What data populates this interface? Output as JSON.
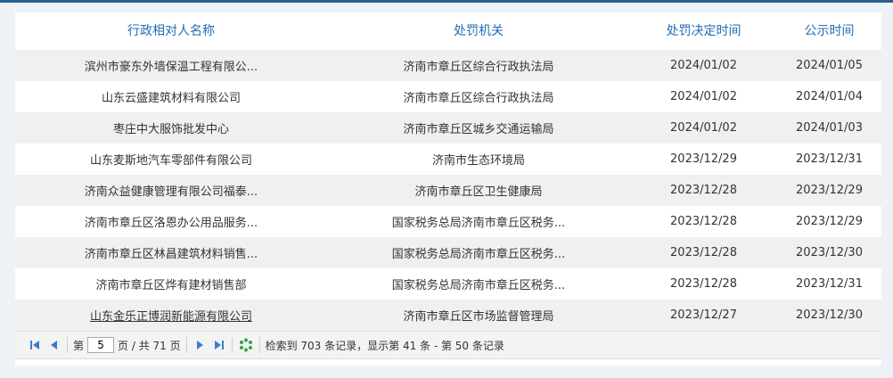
{
  "table": {
    "headers": [
      "行政相对人名称",
      "处罚机关",
      "处罚决定时间",
      "公示时间"
    ],
    "rows": [
      [
        "滨州市豪东外墙保温工程有限公...",
        "济南市章丘区综合行政执法局",
        "2024/01/02",
        "2024/01/05"
      ],
      [
        "山东云盛建筑材料有限公司",
        "济南市章丘区综合行政执法局",
        "2024/01/02",
        "2024/01/04"
      ],
      [
        "枣庄中大服饰批发中心",
        "济南市章丘区城乡交通运输局",
        "2024/01/02",
        "2024/01/03"
      ],
      [
        "山东麦斯地汽车零部件有限公司",
        "济南市生态环境局",
        "2023/12/29",
        "2023/12/31"
      ],
      [
        "济南众益健康管理有限公司福泰...",
        "济南市章丘区卫生健康局",
        "2023/12/28",
        "2023/12/29"
      ],
      [
        "济南市章丘区洛恩办公用品服务...",
        "国家税务总局济南市章丘区税务...",
        "2023/12/28",
        "2023/12/29"
      ],
      [
        "济南市章丘区林昌建筑材料销售...",
        "国家税务总局济南市章丘区税务...",
        "2023/12/28",
        "2023/12/30"
      ],
      [
        "济南市章丘区烨有建材销售部",
        "国家税务总局济南市章丘区税务...",
        "2023/12/28",
        "2023/12/31"
      ],
      [
        "山东金乐正博润新能源有限公司",
        "济南市章丘区市场监督管理局",
        "2023/12/27",
        "2023/12/30"
      ]
    ]
  },
  "pager": {
    "page_prefix": "第",
    "current_page": "5",
    "page_suffix": "页 / 共 71 页",
    "summary": "检索到 703 条记录，显示第 41 条 - 第 50 条记录"
  },
  "icons": {
    "first": "first-page-icon",
    "prev": "prev-page-icon",
    "next": "next-page-icon",
    "last": "last-page-icon",
    "refresh": "refresh-icon"
  },
  "colors": {
    "header_text": "#1f6db5",
    "top_line": "#2b5f8f",
    "stripe": "#f0f0f0",
    "pager_icon": "#3a7fc9",
    "refresh_icon": "#3aa24a"
  }
}
